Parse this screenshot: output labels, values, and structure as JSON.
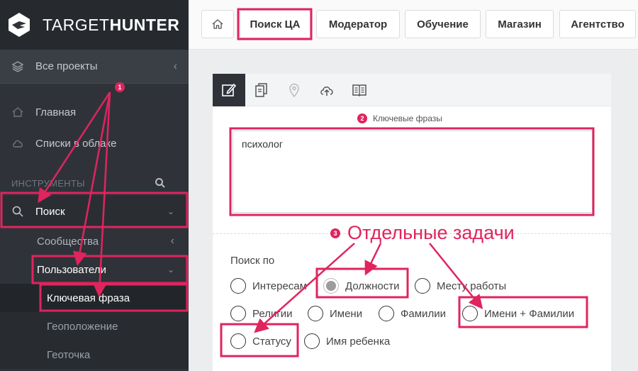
{
  "brand": {
    "name_part1": "TARGET",
    "name_part2": "HUNTER"
  },
  "sidebar": {
    "all_projects": "Все проекты",
    "nav": [
      {
        "label": "Главная",
        "icon": "home-icon"
      },
      {
        "label": "Списки в облаке",
        "icon": "cloud-icon"
      }
    ],
    "tools_header": "ИНСТРУМЕНТЫ",
    "search_label": "Поиск",
    "sub_communities": "Сообщества",
    "sub_users": "Пользователи",
    "subsub": [
      "Ключевая фраза",
      "Геоположение",
      "Геоточка"
    ]
  },
  "topnav": {
    "tabs": [
      "Поиск ЦА",
      "Модератор",
      "Обучение",
      "Магазин",
      "Агентство"
    ]
  },
  "main": {
    "keyword_label": "Ключевые фразы",
    "keyword_value": "психолог",
    "search_by_label": "Поиск по",
    "options": [
      "Интересам",
      "Должности",
      "Месту работы",
      "Религии",
      "Имени",
      "Фамилии",
      "Имени + Фамилии",
      "Статусу",
      "Имя ребенка"
    ],
    "selected_option": "Должности"
  },
  "annotations": {
    "big_text": "Отдельные задачи",
    "markers": [
      "1",
      "2",
      "3"
    ]
  },
  "colors": {
    "annotation": "#e0245e",
    "sidebar_bg": "#2f3339"
  }
}
